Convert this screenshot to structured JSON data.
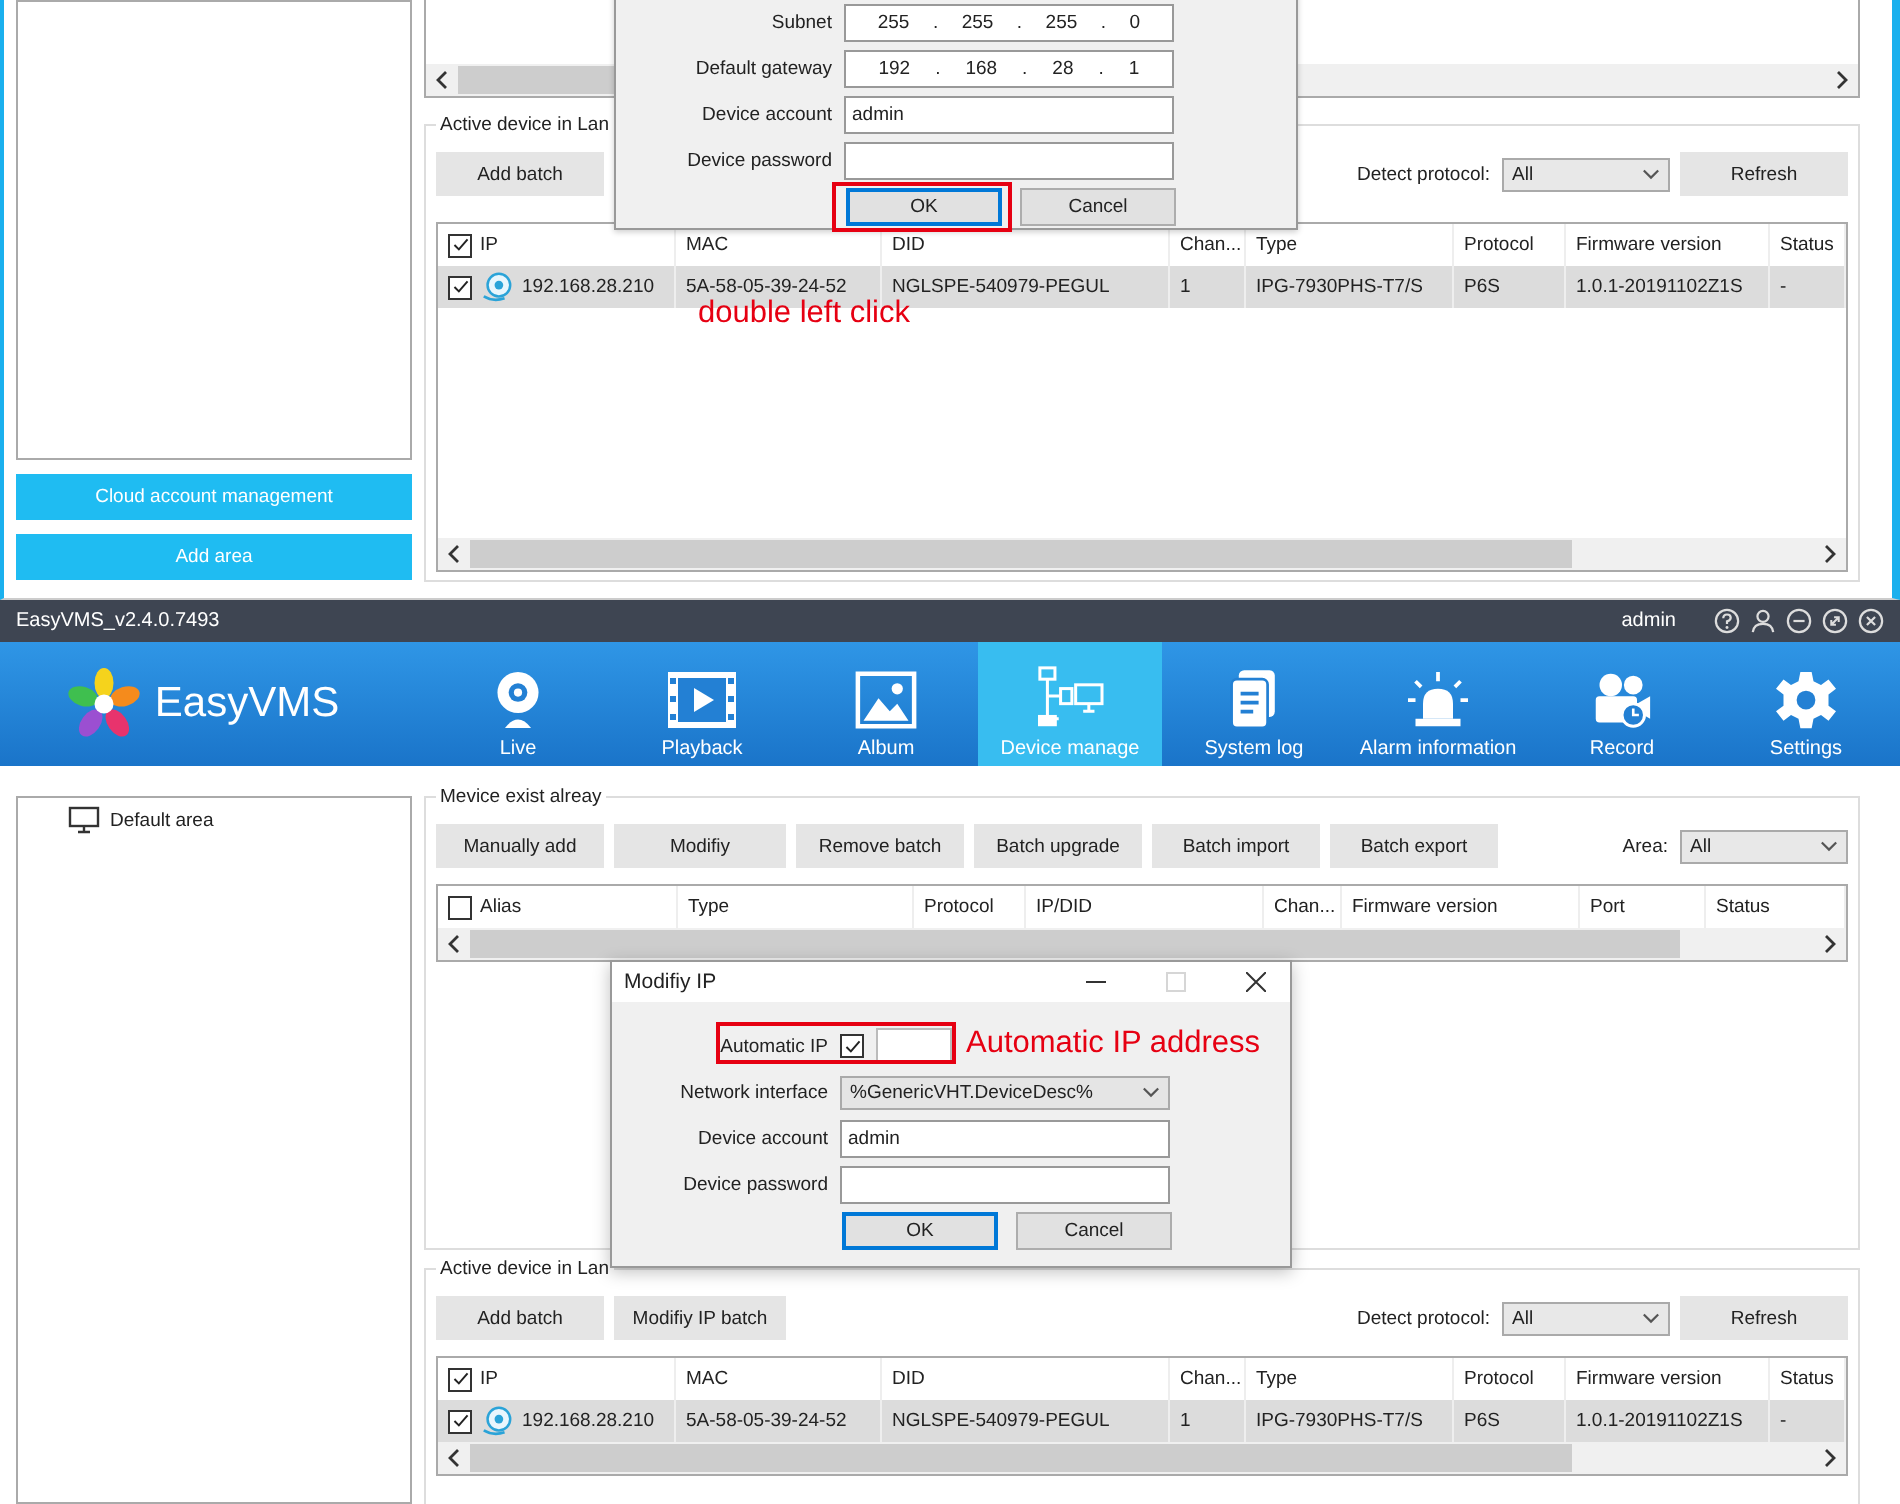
{
  "top_screen": {
    "sidebar_buttons": [
      "Cloud account management",
      "Add area"
    ],
    "active_devices": {
      "title": "Active device in Lan",
      "buttons": [
        "Add batch"
      ],
      "detect_label": "Detect protocol:",
      "detect_value": "All",
      "refresh": "Refresh",
      "header_checked": true,
      "columns": [
        "IP",
        "MAC",
        "DID",
        "Chan...",
        "Type",
        "Protocol",
        "Firmware version",
        "Status"
      ],
      "rows": [
        {
          "selected": true,
          "checked": true,
          "cells": [
            "192.168.28.210",
            "5A-58-05-39-24-52",
            "NGLSPE-540979-PEGUL",
            "1",
            "IPG-7930PHS-T7/S",
            "P6S",
            "1.0.1-20191102Z1S",
            "-"
          ]
        }
      ]
    },
    "dialog": {
      "fields": [
        {
          "kind": "ip",
          "label": "Subnet",
          "octets": [
            "255",
            "255",
            "255",
            "0"
          ],
          "separator": "."
        },
        {
          "kind": "ip",
          "label": "Default gateway",
          "octets": [
            "192",
            "168",
            "28",
            "1"
          ],
          "separator": "."
        },
        {
          "kind": "text",
          "label": "Device account",
          "value": "admin"
        },
        {
          "kind": "password",
          "label": "Device password"
        }
      ],
      "buttons": [
        {
          "label": "OK",
          "annotated": true
        },
        {
          "label": "Cancel",
          "annotated": false
        }
      ]
    },
    "annotation": "double left click"
  },
  "bottom_screen": {
    "title": "EasyVMS_v2.4.0.7493",
    "user": "admin",
    "logo": "EasyVMS",
    "nav": [
      {
        "label": "Live",
        "selected": false
      },
      {
        "label": "Playback",
        "selected": false
      },
      {
        "label": "Album",
        "selected": false
      },
      {
        "label": "Device manage",
        "selected": true
      },
      {
        "label": "System log",
        "selected": false
      },
      {
        "label": "Alarm information",
        "selected": false
      },
      {
        "label": "Record",
        "selected": false
      },
      {
        "label": "Settings",
        "selected": false
      }
    ],
    "tree": [
      {
        "label": "Default area"
      }
    ],
    "existing": {
      "title": "Mevice exist alreay",
      "buttons": [
        "Manually add",
        "Modifiy",
        "Remove batch",
        "Batch upgrade",
        "Batch import",
        "Batch export"
      ],
      "area_label": "Area:",
      "area_value": "All",
      "header_checked": false,
      "columns": [
        "Alias",
        "Type",
        "Protocol",
        "IP/DID",
        "Chan...",
        "Firmware version",
        "Port",
        "Status"
      ]
    },
    "dialog": {
      "title": "Modifiy IP",
      "fields": [
        {
          "kind": "checkbox",
          "label": "Automatic IP",
          "checked": true,
          "annotated": true
        },
        {
          "kind": "select",
          "label": "Network interface",
          "value": "%GenericVHT.DeviceDesc%"
        },
        {
          "kind": "text",
          "label": "Device account",
          "value": "admin"
        },
        {
          "kind": "password",
          "label": "Device password"
        }
      ],
      "buttons": [
        {
          "label": "OK",
          "annotated": false
        },
        {
          "label": "Cancel",
          "annotated": false
        }
      ],
      "annotation": "Automatic IP address"
    },
    "active_devices": {
      "title": "Active device in Lan",
      "buttons": [
        "Add batch",
        "Modifiy IP batch"
      ],
      "detect_label": "Detect protocol:",
      "detect_value": "All",
      "refresh": "Refresh",
      "header_checked": true,
      "columns": [
        "IP",
        "MAC",
        "DID",
        "Chan...",
        "Type",
        "Protocol",
        "Firmware version",
        "Status"
      ],
      "rows": [
        {
          "selected": true,
          "checked": true,
          "cells": [
            "192.168.28.210",
            "5A-58-05-39-24-52",
            "NGLSPE-540979-PEGUL",
            "1",
            "IPG-7930PHS-T7/S",
            "P6S",
            "1.0.1-20191102Z1S",
            "-"
          ]
        }
      ]
    }
  }
}
